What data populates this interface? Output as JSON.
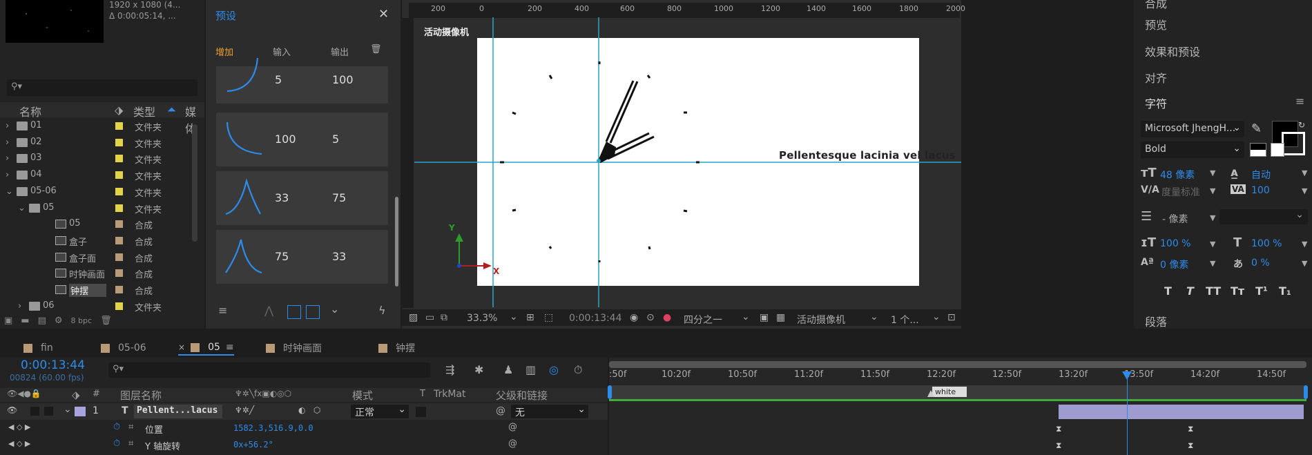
{
  "project": {
    "thumb_info_1": "1920 x 1080 (4...",
    "thumb_info_2": "Δ 0:00:05:14, ...",
    "search_placeholder": "",
    "cols": {
      "name": "名称",
      "type": "类型",
      "media": "媒体"
    },
    "items": [
      {
        "label": "01",
        "type": "文件夹",
        "kind": "folder",
        "indent": 0,
        "arrow": "›",
        "color": "#e3d34a"
      },
      {
        "label": "02",
        "type": "文件夹",
        "kind": "folder",
        "indent": 0,
        "arrow": "›",
        "color": "#e3d34a"
      },
      {
        "label": "03",
        "type": "文件夹",
        "kind": "folder",
        "indent": 0,
        "arrow": "›",
        "color": "#e3d34a"
      },
      {
        "label": "04",
        "type": "文件夹",
        "kind": "folder",
        "indent": 0,
        "arrow": "›",
        "color": "#e3d34a"
      },
      {
        "label": "05-06",
        "type": "文件夹",
        "kind": "folder",
        "indent": 0,
        "arrow": "⌄",
        "color": "#e3d34a"
      },
      {
        "label": "05",
        "type": "文件夹",
        "kind": "folder",
        "indent": 1,
        "arrow": "⌄",
        "color": "#e3d34a"
      },
      {
        "label": "05",
        "type": "合成",
        "kind": "comp",
        "indent": 2,
        "arrow": "",
        "color": "#b89a77"
      },
      {
        "label": "盒子",
        "type": "合成",
        "kind": "comp",
        "indent": 2,
        "arrow": "",
        "color": "#b89a77"
      },
      {
        "label": "盒子面",
        "type": "合成",
        "kind": "comp",
        "indent": 2,
        "arrow": "",
        "color": "#b89a77"
      },
      {
        "label": "时钟画面",
        "type": "合成",
        "kind": "comp",
        "indent": 2,
        "arrow": "",
        "color": "#b89a77"
      },
      {
        "label": "钟摆",
        "type": "合成",
        "kind": "comp",
        "indent": 2,
        "arrow": "",
        "color": "#b89a77",
        "selected": true
      },
      {
        "label": "06",
        "type": "文件夹",
        "kind": "folder",
        "indent": 1,
        "arrow": "›",
        "color": "#e3d34a"
      }
    ],
    "bpc": "8 bpc"
  },
  "presets": {
    "title": "预设",
    "tabs": {
      "add": "增加",
      "input": "输入",
      "output": "输出"
    },
    "cards": [
      {
        "v1": "5",
        "v2": "100",
        "curve": "in"
      },
      {
        "v1": "100",
        "v2": "5",
        "curve": "out"
      },
      {
        "v1": "33",
        "v2": "75",
        "curve": "peak_right"
      },
      {
        "v1": "75",
        "v2": "33",
        "curve": "peak_left"
      }
    ]
  },
  "viewer": {
    "camera_label": "活动摄像机",
    "ruler_ticks": [
      "200",
      "0",
      "200",
      "400",
      "600",
      "800",
      "1000",
      "1200",
      "1400",
      "1600",
      "1800",
      "2000"
    ],
    "text_layer": "Pellentesque lacinia vel lacus",
    "axis_x": "X",
    "axis_y": "Y",
    "zoom": "33.3%",
    "timecode": "0:00:13:44",
    "resolution": "四分之一",
    "view": "活动摄像机",
    "views": "1 个..."
  },
  "right_panel": {
    "items": [
      "合成",
      "预览",
      "效果和预设",
      "对齐"
    ],
    "character": {
      "title": "字符",
      "font": "Microsoft JhengH...",
      "style": "Bold",
      "size": "48 像素",
      "leading": "自动",
      "kerning": "度量标准",
      "tracking": "100",
      "stroke": "- 像素",
      "vscale": "100 %",
      "hscale": "100 %",
      "baseline": "0 像素",
      "tsume": "0 %"
    },
    "styles": [
      "T",
      "T",
      "TT",
      "Tт",
      "T¹",
      "T₁"
    ],
    "paragraph": "段落"
  },
  "tabs": [
    {
      "label": "fin",
      "color": "#b89a77"
    },
    {
      "label": "05-06",
      "color": "#b89a77"
    },
    {
      "label": "05",
      "color": "#b89a77",
      "active": true
    },
    {
      "label": "时钟画面",
      "color": "#b89a77"
    },
    {
      "label": "钟摆",
      "color": "#b89a77"
    }
  ],
  "timeline": {
    "timecode": "0:00:13:44",
    "fps": "00824 (60.00 fps)",
    "cols": {
      "num": "#",
      "name": "图层名称",
      "mode": "模式",
      "t": "T",
      "trkmat": "TrkMat",
      "parent": "父级和链接"
    },
    "layer": {
      "num": "1",
      "type": "T",
      "name": "Pellent...lacus",
      "mode": "正常",
      "parent": "无"
    },
    "props": [
      {
        "name": "位置",
        "value": "1582.3,516.9,0.0"
      },
      {
        "name": "Y 轴旋转",
        "value": "0x+56.2°"
      }
    ],
    "time_labels": [
      ":50f",
      "10:20f",
      "10:50f",
      "11:20f",
      "11:50f",
      "12:20f",
      "12:50f",
      "13:20f",
      "13:50f",
      "14:20f",
      "14:50f"
    ],
    "marker": "white"
  }
}
